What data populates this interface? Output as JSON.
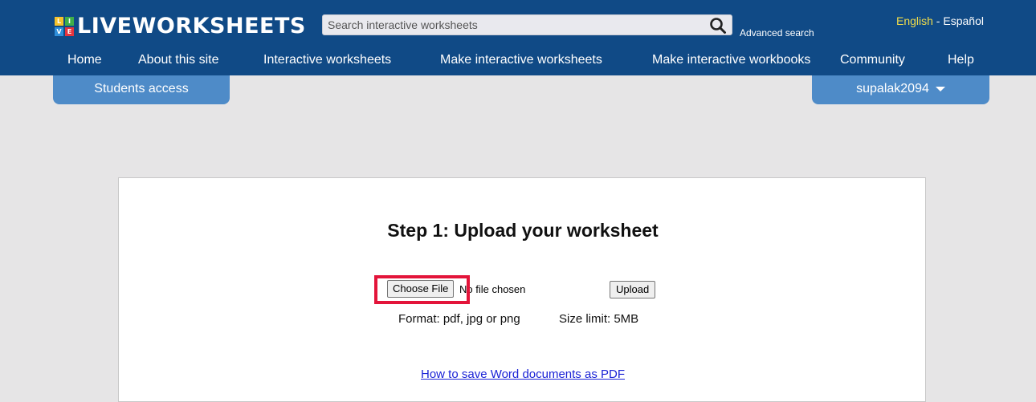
{
  "brand": {
    "name": "LIVEWORKSHEETS",
    "logo_letters": [
      "L",
      "I",
      "V",
      "E"
    ],
    "logo_colors": [
      "#f6c22b",
      "#3fae49",
      "#2f8fdb",
      "#e4343e"
    ]
  },
  "search": {
    "placeholder": "Search interactive worksheets",
    "advanced_label": "Advanced search"
  },
  "languages": {
    "current": "English",
    "separator": " - ",
    "other": "Español"
  },
  "nav": {
    "items": [
      {
        "label": "Home"
      },
      {
        "label": "About this site"
      },
      {
        "label": "Interactive worksheets"
      },
      {
        "label": "Make interactive worksheets"
      },
      {
        "label": "Make interactive workbooks"
      },
      {
        "label": "Community"
      },
      {
        "label": "Help"
      }
    ]
  },
  "tabs": {
    "students": "Students access",
    "user": "supalak2094"
  },
  "upload": {
    "title": "Step 1: Upload your worksheet",
    "choose_file": "Choose File",
    "file_status": "No file chosen",
    "upload_button": "Upload",
    "format": "Format: pdf, jpg or png",
    "size_limit": "Size limit: 5MB",
    "help_link": "How to save Word documents as PDF"
  },
  "colors": {
    "header_bg": "#104a86",
    "tab_bg": "#4e8bc8",
    "page_bg": "#e6e5e6",
    "highlight": "#e3143a",
    "lang_active": "#f0dc4a"
  }
}
